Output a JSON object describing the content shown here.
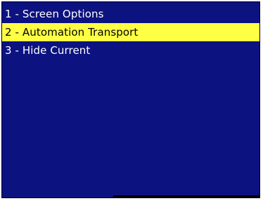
{
  "menu": {
    "items": [
      {
        "label": "1 - Screen Options",
        "selected": false
      },
      {
        "label": "2 - Automation Transport",
        "selected": true
      },
      {
        "label": "3 - Hide Current",
        "selected": false
      }
    ]
  },
  "colors": {
    "panel_background": "#0c1280",
    "highlight": "#ffff44",
    "text": "#ffffff",
    "selected_text": "#000000"
  }
}
